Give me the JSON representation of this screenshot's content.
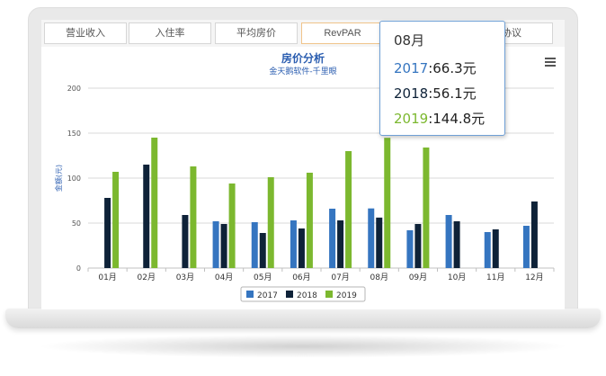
{
  "tabs": [
    {
      "label": "营业收入",
      "active": false
    },
    {
      "label": "入住率",
      "active": false
    },
    {
      "label": "平均房价",
      "active": false
    },
    {
      "label": "RevPAR",
      "active": true
    },
    {
      "label": "",
      "active": false
    },
    {
      "label": "协议",
      "active": false
    }
  ],
  "menu_icon": "hamburger-menu-icon",
  "tooltip": {
    "title": "08月",
    "rows": [
      {
        "year": "2017",
        "text": ":66.3元",
        "color": "#3575c0"
      },
      {
        "year": "2018",
        "text": ":56.1元",
        "color": "#0e2238"
      },
      {
        "year": "2019",
        "text": ":144.8元",
        "color": "#7cb82f"
      }
    ]
  },
  "chart_data": {
    "type": "bar",
    "title": "房价分析",
    "subtitle": "金天鹅软件-千里眼",
    "ylabel": "金额(元)",
    "xlabel": "",
    "ylim": [
      0,
      200
    ],
    "yticks": [
      0,
      50,
      100,
      150,
      200
    ],
    "grid": true,
    "legend_position": "bottom",
    "categories": [
      "01月",
      "02月",
      "03月",
      "04月",
      "05月",
      "06月",
      "07月",
      "08月",
      "09月",
      "10月",
      "11月",
      "12月"
    ],
    "series": [
      {
        "name": "2017",
        "color": "#3575c0",
        "values": [
          0,
          0,
          0,
          52,
          51,
          53,
          66,
          66.3,
          42,
          59,
          40,
          47
        ]
      },
      {
        "name": "2018",
        "color": "#0e2238",
        "values": [
          78,
          115,
          59,
          49,
          39,
          44,
          53,
          56.1,
          49,
          52,
          43,
          74
        ]
      },
      {
        "name": "2019",
        "color": "#7cb82f",
        "values": [
          107,
          145,
          113,
          94,
          101,
          106,
          130,
          144.8,
          134,
          0,
          0,
          0
        ]
      }
    ]
  }
}
